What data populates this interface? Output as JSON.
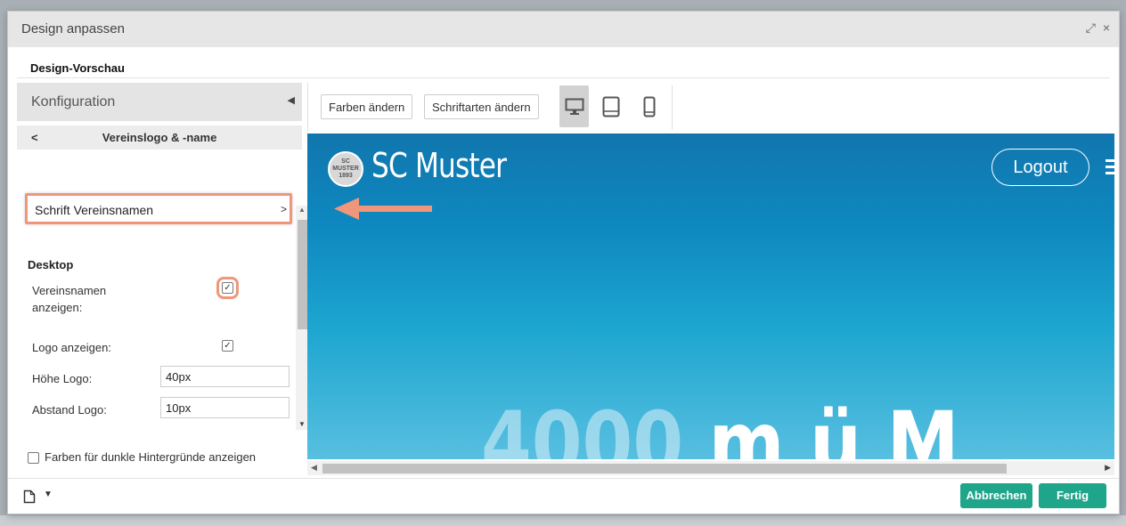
{
  "dialog": {
    "title": "Design anpassen",
    "expand_icon": "⤢",
    "close_icon": "×"
  },
  "preview_section": {
    "heading": "Design-Vorschau"
  },
  "config": {
    "header": "Konfiguration",
    "collapse_arrow": "◀",
    "back": "<",
    "subheader": "Vereinslogo & -name",
    "font_row": {
      "label": "Schrift Vereinsnamen",
      "chevron": ">"
    },
    "desktop_heading": "Desktop",
    "show_club_name": {
      "label": "Vereinsnamen anzeigen:",
      "checked": true
    },
    "show_logo": {
      "label": "Logo anzeigen:",
      "checked": true
    },
    "logo_height": {
      "label": "Höhe Logo:",
      "value": "40px"
    },
    "logo_spacing": {
      "label": "Abstand Logo:",
      "value": "10px"
    },
    "dark_colors": {
      "label": "Farben für dunkle Hintergründe anzeigen",
      "checked": false
    }
  },
  "toolbar": {
    "colors_button": "Farben ändern",
    "fonts_button": "Schriftarten ändern",
    "devices": [
      {
        "name": "desktop",
        "active": true
      },
      {
        "name": "tablet",
        "active": false
      },
      {
        "name": "mobile",
        "active": false
      }
    ]
  },
  "preview": {
    "logo_text": "SC MUSTER 1893",
    "club_name": "SC Muster",
    "logout": "Logout",
    "big_text_faded": "4000",
    "big_text": "m ü M"
  },
  "footer": {
    "cancel": "Abbrechen",
    "done": "Fertig"
  },
  "colors": {
    "highlight": "#f0967a",
    "primary_button": "#1fa68a"
  }
}
